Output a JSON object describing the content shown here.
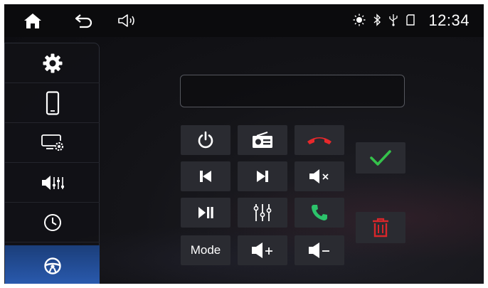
{
  "status_bar": {
    "clock": "12:34",
    "icons": [
      "home-icon",
      "back-icon",
      "volume-icon",
      "brightness-icon",
      "bluetooth-icon",
      "usb-icon",
      "sd-card-icon"
    ]
  },
  "sidebar": {
    "items": [
      {
        "icon": "gear-icon",
        "active": false
      },
      {
        "icon": "phone-icon",
        "active": false
      },
      {
        "icon": "display-settings-icon",
        "active": false
      },
      {
        "icon": "audio-settings-icon",
        "active": false
      },
      {
        "icon": "clock-icon",
        "active": false
      },
      {
        "icon": "steering-wheel-icon",
        "active": true
      }
    ]
  },
  "display": {
    "value": ""
  },
  "keypad": {
    "mode_label": "Mode",
    "buttons": [
      "power-icon",
      "radio-icon",
      "hang-up-icon",
      "previous-track-icon",
      "next-track-icon",
      "mute-icon",
      "play-pause-icon",
      "equalizer-icon",
      "answer-call-icon",
      "mode",
      "volume-up-icon",
      "volume-down-icon"
    ]
  },
  "actions": [
    "confirm-icon",
    "delete-icon"
  ],
  "colors": {
    "accent_blue": "#2a5bb0",
    "hangup_red": "#e8282b",
    "answer_green": "#2cc36b",
    "confirm_green": "#35c24b",
    "delete_red": "#d9262a",
    "button_bg": "#2a2b31"
  }
}
